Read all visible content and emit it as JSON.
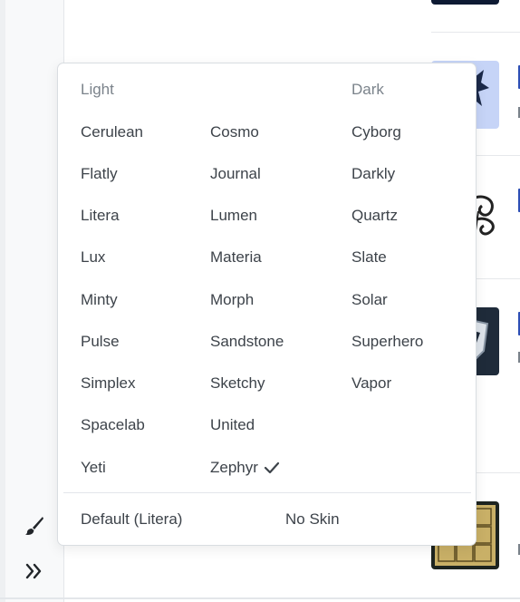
{
  "theme_menu": {
    "headers": {
      "light": "Light",
      "dark": "Dark"
    },
    "light_col1": [
      "Cerulean",
      "Flatly",
      "Litera",
      "Lux",
      "Minty",
      "Pulse",
      "Simplex",
      "Spacelab",
      "Yeti"
    ],
    "light_col2": [
      "Cosmo",
      "Journal",
      "Lumen",
      "Materia",
      "Morph",
      "Sandstone",
      "Sketchy",
      "United",
      "Zephyr"
    ],
    "dark": [
      "Cyborg",
      "Darkly",
      "Quartz",
      "Slate",
      "Solar",
      "Superhero",
      "Vapor"
    ],
    "selected": "Zephyr",
    "footer": {
      "default_label": "Default (Litera)",
      "no_skin_label": "No Skin"
    }
  },
  "sidebar": {
    "icons": [
      "paintbrush-icon",
      "double-chevron-right-icon"
    ]
  },
  "colors": {
    "accent": "#2d4fb5",
    "text": "#3d434a",
    "muted": "#7b838b"
  }
}
